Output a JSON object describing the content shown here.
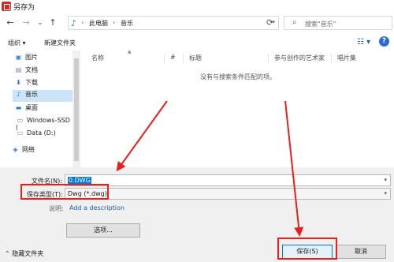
{
  "window": {
    "title": "另存为"
  },
  "nav": {
    "back": "←",
    "forward": "→",
    "recent": "⌄",
    "up": "↑",
    "path": [
      "此电脑",
      "音乐"
    ],
    "path_sep": "›",
    "refresh": "⟳",
    "search_placeholder": "搜索\"音乐\""
  },
  "toolbar": {
    "organize": "组织 ▾",
    "new_folder": "新建文件夹",
    "view": "☷ ▾",
    "help": "?"
  },
  "sidebar": {
    "items": [
      {
        "label": "图片",
        "icon": "picture-icon"
      },
      {
        "label": "文档",
        "icon": "document-icon"
      },
      {
        "label": "下载",
        "icon": "download-icon"
      },
      {
        "label": "音乐",
        "icon": "music-icon",
        "selected": true
      },
      {
        "label": "桌面",
        "icon": "desktop-icon"
      },
      {
        "label": "Windows-SSD (",
        "icon": "drive-icon"
      },
      {
        "label": "Data (D:)",
        "icon": "drive-icon"
      },
      {
        "label": "网络",
        "icon": "network-icon"
      }
    ]
  },
  "filelist": {
    "columns": [
      "名称",
      "#",
      "标题",
      "参与创作的艺术家",
      "唱片集"
    ],
    "empty_message": "没有与搜索条件匹配的项。"
  },
  "form": {
    "filename_label": "文件名(N):",
    "filename_value": "0.DWG",
    "filetype_label": "保存类型(T):",
    "filetype_value": "Dwg (*.dwg)",
    "desc_label": "说明:",
    "desc_link": "Add a description",
    "options_button": "选项..."
  },
  "footer": {
    "hide_folders": "隐藏文件夹",
    "save_button": "保存(S)",
    "cancel_button": "取消"
  },
  "colors": {
    "annotation": "#e8201c",
    "selection": "#cce4f7",
    "accent": "#0078d7"
  }
}
